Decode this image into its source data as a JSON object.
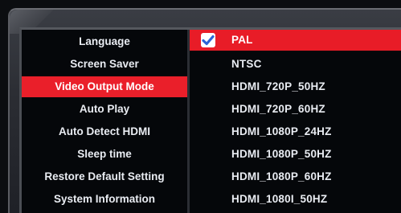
{
  "settings_menu": {
    "categories": [
      {
        "label": "Language"
      },
      {
        "label": "Screen Saver"
      },
      {
        "label": "Video Output Mode"
      },
      {
        "label": "Auto Play"
      },
      {
        "label": "Auto Detect HDMI"
      },
      {
        "label": "Sleep time"
      },
      {
        "label": "Restore Default Setting"
      },
      {
        "label": "System Information"
      }
    ],
    "selected_category": "Video Output Mode",
    "options": [
      {
        "label": "PAL"
      },
      {
        "label": "NTSC"
      },
      {
        "label": "HDMI_720P_50HZ"
      },
      {
        "label": "HDMI_720P_60HZ"
      },
      {
        "label": "HDMI_1080P_24HZ"
      },
      {
        "label": "HDMI_1080P_50HZ"
      },
      {
        "label": "HDMI_1080P_60HZ"
      },
      {
        "label": "HDMI_1080I_50HZ"
      }
    ],
    "selected_option": "PAL",
    "check_icon": "checkmark-icon",
    "colors": {
      "highlight": "#ea1f2a",
      "text": "#e9ecf2",
      "panel_background": "#05070a"
    }
  }
}
